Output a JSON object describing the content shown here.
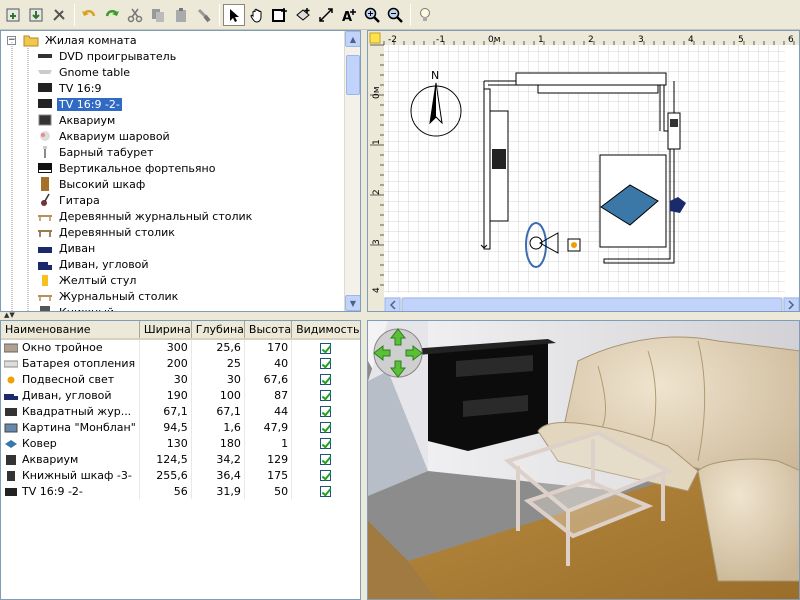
{
  "toolbar": {
    "icons": [
      "new-home-icon",
      "open-icon",
      "preferences-icon",
      "undo-icon",
      "redo-icon",
      "cut-icon",
      "copy-icon",
      "paste-icon",
      "delete-icon",
      "select-mode-icon",
      "pan-mode-icon",
      "create-walls-icon",
      "create-rooms-icon",
      "create-dimensions-icon",
      "add-text-icon",
      "zoom-in-icon",
      "zoom-out-icon",
      "tips-icon"
    ]
  },
  "furniture_tree": {
    "root_label": "Жилая комната",
    "items": [
      {
        "label": "DVD проигрыватель",
        "icon": "dvd-player-icon"
      },
      {
        "label": "Gnome table",
        "icon": "table-icon"
      },
      {
        "label": "TV 16:9",
        "icon": "tv-icon"
      },
      {
        "label": "TV 16:9 -2-",
        "icon": "tv-icon",
        "selected": true
      },
      {
        "label": "Аквариум",
        "icon": "aquarium-icon"
      },
      {
        "label": "Аквариум шаровой",
        "icon": "round-aquarium-icon"
      },
      {
        "label": "Барный табурет",
        "icon": "bar-stool-icon"
      },
      {
        "label": "Вертикальное фортепьяно",
        "icon": "piano-icon"
      },
      {
        "label": "Высокий шкаф",
        "icon": "tall-cabinet-icon"
      },
      {
        "label": "Гитара",
        "icon": "guitar-icon"
      },
      {
        "label": "Деревянный журнальный столик",
        "icon": "coffee-table-icon"
      },
      {
        "label": "Деревянный столик",
        "icon": "wooden-table-icon"
      },
      {
        "label": "Диван",
        "icon": "sofa-icon"
      },
      {
        "label": "Диван, угловой",
        "icon": "corner-sofa-icon"
      },
      {
        "label": "Желтый стул",
        "icon": "yellow-chair-icon"
      },
      {
        "label": "Журнальный столик",
        "icon": "coffee-table-icon"
      },
      {
        "label": "Книжный ...",
        "icon": "bookcase-icon"
      }
    ]
  },
  "furniture_table": {
    "headers": [
      "Наименование",
      "Ширина",
      "Глубина",
      "Высота",
      "Видимость"
    ],
    "rows": [
      {
        "name": "Окно тройное",
        "w": "300",
        "d": "25,6",
        "h": "170",
        "icon": "window-icon",
        "visible": true
      },
      {
        "name": "Батарея отопления",
        "w": "200",
        "d": "25",
        "h": "40",
        "icon": "radiator-icon",
        "visible": true
      },
      {
        "name": "Подвесной свет",
        "w": "30",
        "d": "30",
        "h": "67,6",
        "icon": "light-icon",
        "visible": true
      },
      {
        "name": "Диван, угловой",
        "w": "190",
        "d": "100",
        "h": "87",
        "icon": "corner-sofa-icon",
        "visible": true
      },
      {
        "name": "Квадратный жур...",
        "w": "67,1",
        "d": "67,1",
        "h": "44",
        "icon": "square-table-icon",
        "visible": true
      },
      {
        "name": "Картина \"Монблан\"",
        "w": "94,5",
        "d": "1,6",
        "h": "47,9",
        "icon": "painting-icon",
        "visible": true
      },
      {
        "name": "Ковер",
        "w": "130",
        "d": "180",
        "h": "1",
        "icon": "carpet-icon",
        "visible": true
      },
      {
        "name": "Аквариум",
        "w": "124,5",
        "d": "34,2",
        "h": "129",
        "icon": "aquarium-icon",
        "visible": true
      },
      {
        "name": "Книжный шкаф -3-",
        "w": "255,6",
        "d": "36,4",
        "h": "175",
        "icon": "bookcase-icon",
        "visible": true
      },
      {
        "name": "TV 16:9 -2-",
        "w": "56",
        "d": "31,9",
        "h": "50",
        "icon": "tv-icon",
        "visible": true
      }
    ]
  },
  "plan": {
    "ruler_x": [
      "-2",
      "-1",
      "0м",
      "1",
      "2",
      "3",
      "4",
      "5",
      "6"
    ],
    "ruler_y": [
      "0м",
      "1",
      "2",
      "3",
      "4"
    ],
    "compass_label": "N"
  },
  "colors": {
    "selection": "#316ac5",
    "panel_bg": "#ece9d8",
    "grid": "#c0c0c0"
  }
}
